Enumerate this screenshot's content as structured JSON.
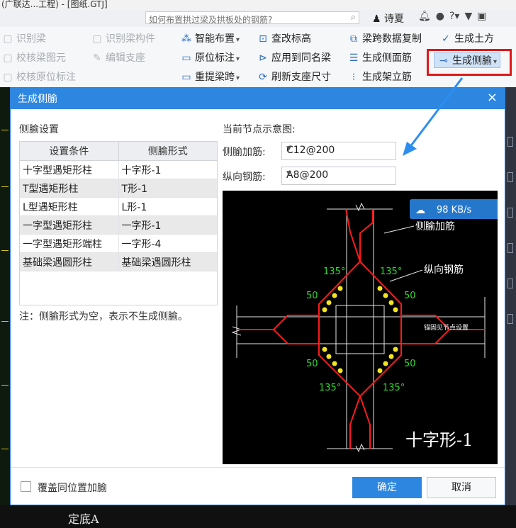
{
  "app": {
    "title": "(广联达...工程) - [图纸.GTJ]",
    "search_placeholder": "如何布置拱过梁及拱板处的钢筋?",
    "user_name": "诗夏"
  },
  "ribbon": {
    "col1": [
      "识别梁",
      "校核梁图元",
      "校核原位标注"
    ],
    "col2": [
      "识别梁构件",
      "编辑支座"
    ],
    "col3": [
      "智能布置",
      "原位标注",
      "重提梁跨"
    ],
    "col4": [
      "查改标高",
      "应用到同名梁",
      "刷新支座尺寸"
    ],
    "col5": [
      "梁跨数据复制",
      "生成侧面筋",
      "生成架立筋"
    ],
    "col6": [
      "生成土方",
      "生成侧腧"
    ]
  },
  "dialog": {
    "title": "生成侧腧",
    "section_left": "侧腧设置",
    "table": {
      "headers": [
        "设置条件",
        "侧腧形式"
      ],
      "rows": [
        [
          "十字型遇矩形柱",
          "十字形-1"
        ],
        [
          "T型遇矩形柱",
          "T形-1"
        ],
        [
          "L型遇矩形柱",
          "L形-1"
        ],
        [
          "一字型遇矩形柱",
          "一字形-1"
        ],
        [
          "一字型遇矩形端柱",
          "一字形-4"
        ],
        [
          "基础梁遇圆形柱",
          "基础梁遇圆形柱"
        ]
      ]
    },
    "note": "注：侧腧形式为空，表示不生成侧腧。",
    "section_right": "当前节点示意图:",
    "haunch_label": "侧腧加筋:",
    "haunch_value": "C12@200",
    "long_label": "纵向钢筋:",
    "long_value": "A8@200",
    "overwrite_label": "覆盖同位置加腧",
    "ok_label": "确定",
    "cancel_label": "取消"
  },
  "diagram": {
    "label_haunch": "侧腧加筋",
    "label_long": "纵向钢筋",
    "label_anchor": "锚固见节点设置",
    "angle": "135°",
    "dim": "50",
    "form_name": "十字形-1",
    "speed": "98 KB/s"
  },
  "canvas": {
    "bottom_text": "定底A"
  }
}
